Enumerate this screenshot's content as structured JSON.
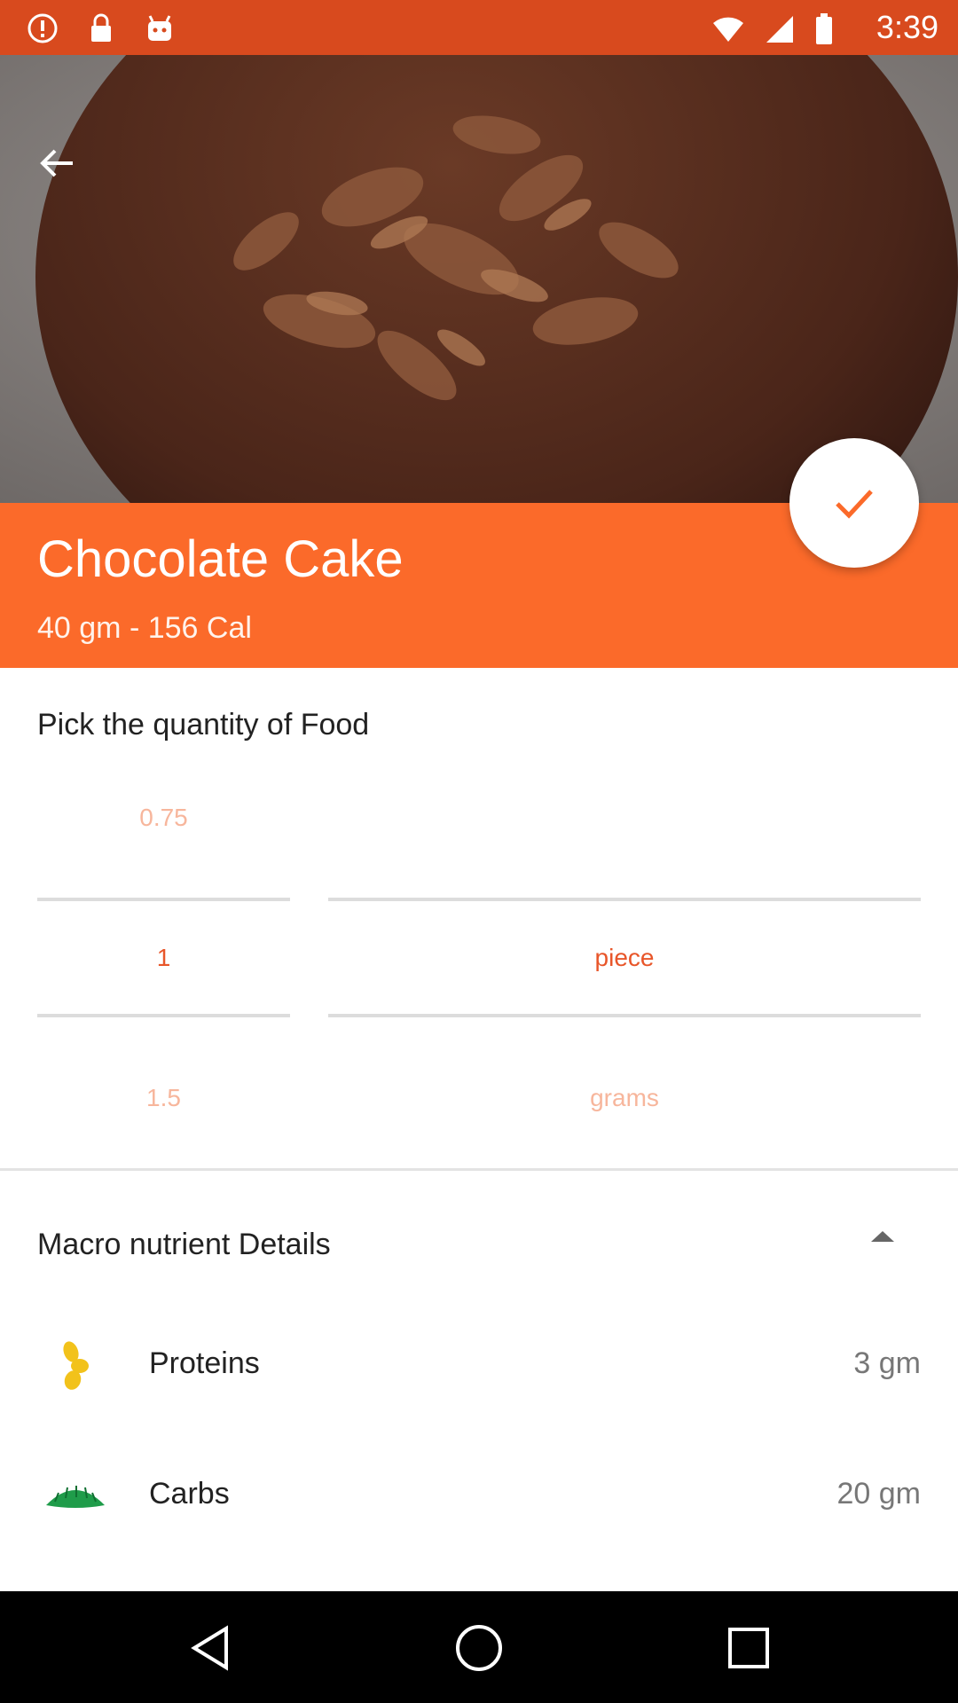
{
  "status_bar": {
    "time": "3:39",
    "icons": [
      "alert-icon",
      "lock-icon",
      "android-icon"
    ]
  },
  "food": {
    "title": "Chocolate Cake",
    "subtitle": "40 gm - 156 Cal"
  },
  "quantity": {
    "heading": "Pick the quantity of Food",
    "amounts": {
      "above": "0.75",
      "selected": "1",
      "below": "1.5"
    },
    "units": {
      "selected": "piece",
      "below": "grams"
    }
  },
  "macros": {
    "heading": "Macro nutrient Details",
    "items": [
      {
        "name": "Proteins",
        "value": "3 gm",
        "icon": "protein-icon"
      },
      {
        "name": "Carbs",
        "value": "20 gm",
        "icon": "carbs-icon"
      }
    ]
  },
  "colors": {
    "accent": "#fb6a2a",
    "status_bar": "#d84a1e",
    "protein": "#f2c21b",
    "carbs": "#1f9c4a"
  }
}
